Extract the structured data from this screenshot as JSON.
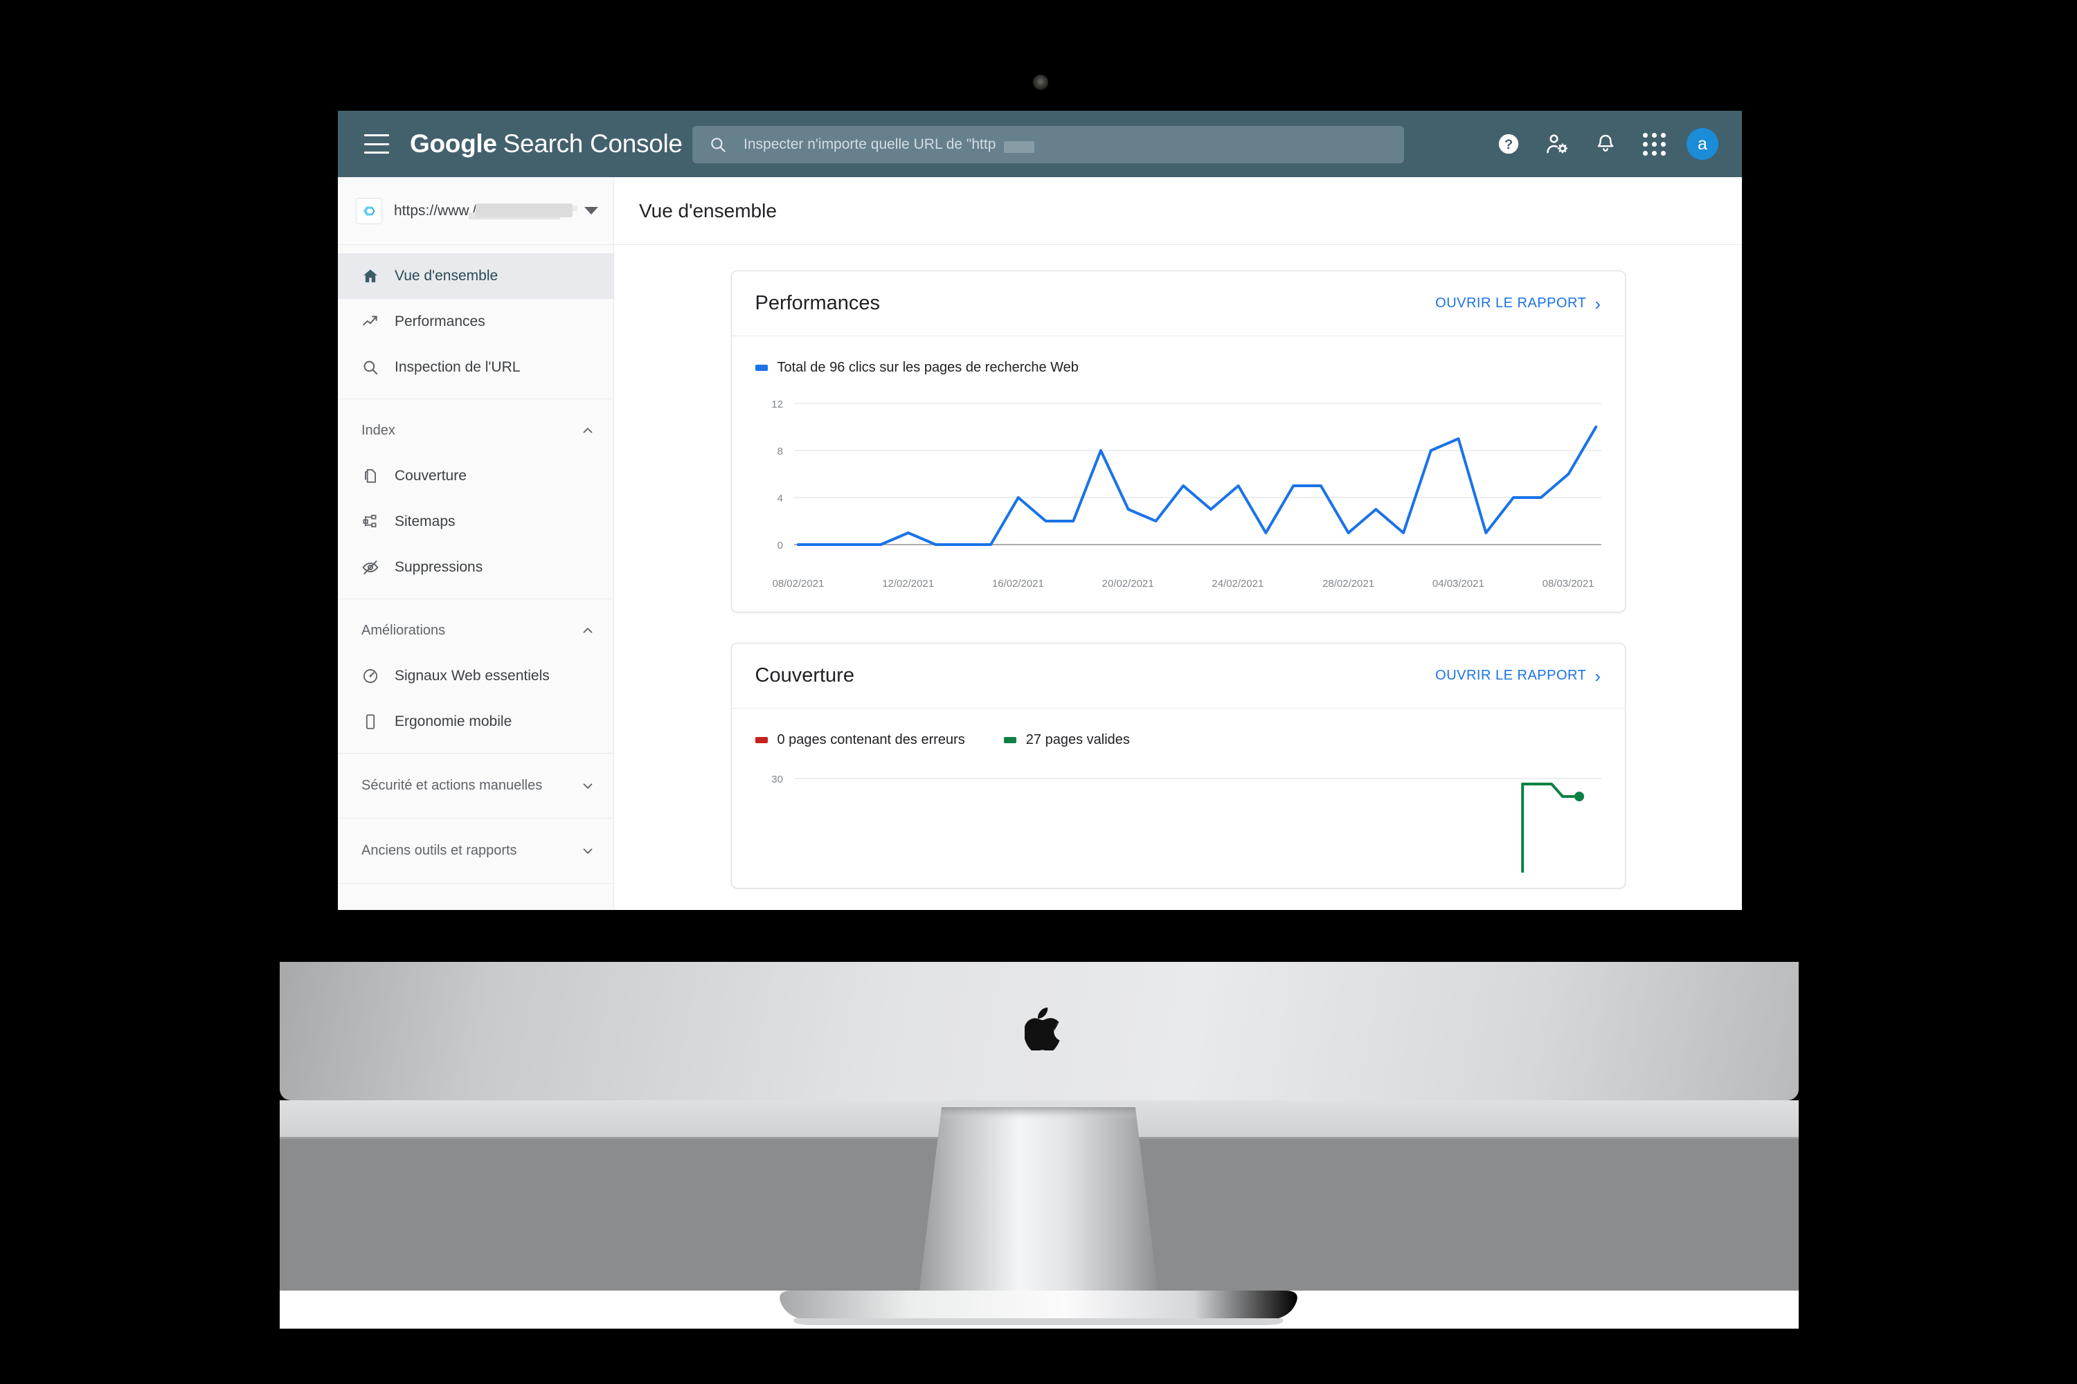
{
  "app": {
    "brand_google": "Google",
    "brand_rest": "Search Console",
    "menu_icon": "hamburger-icon"
  },
  "search": {
    "placeholder": "Inspecter n'importe quelle URL de \"http",
    "value": "",
    "icon": "search-icon"
  },
  "appbar_actions": [
    {
      "name": "help-icon",
      "label": "Aide"
    },
    {
      "name": "user-settings-icon",
      "label": "Paramètres utilisateur"
    },
    {
      "name": "notifications-bell-icon",
      "label": "Notifications"
    },
    {
      "name": "apps-grid-icon",
      "label": "Applications Google"
    }
  ],
  "avatar": {
    "initial": "a",
    "color": "#1a8cd8"
  },
  "property": {
    "url": "https://www.//wwe",
    "logo": "property-logo-c",
    "caret": "chevron-down-icon"
  },
  "sidebar": {
    "primary": [
      {
        "label": "Vue d'ensemble",
        "icon": "home-icon",
        "active": true
      },
      {
        "label": "Performances",
        "icon": "trending-up-icon",
        "active": false
      },
      {
        "label": "Inspection de l'URL",
        "icon": "search-icon",
        "active": false
      }
    ],
    "index": {
      "header": "Index",
      "expanded": true,
      "items": [
        {
          "label": "Couverture",
          "icon": "pages-copy-icon"
        },
        {
          "label": "Sitemaps",
          "icon": "sitemap-icon"
        },
        {
          "label": "Suppressions",
          "icon": "eye-off-icon"
        }
      ]
    },
    "improvements": {
      "header": "Améliorations",
      "expanded": true,
      "items": [
        {
          "label": "Signaux Web essentiels",
          "icon": "speedometer-icon"
        },
        {
          "label": "Ergonomie mobile",
          "icon": "mobile-phone-icon"
        }
      ]
    },
    "sections": [
      {
        "label": "Sécurité et actions manuelles",
        "expanded": false
      },
      {
        "label": "Anciens outils et rapports",
        "expanded": false
      }
    ]
  },
  "page": {
    "title": "Vue d'ensemble"
  },
  "cards": [
    {
      "title": "Performances",
      "open_report": "OUVRIR LE RAPPORT",
      "legend": [
        {
          "label": "Total de 96 clics sur les pages de recherche Web",
          "color": "#1a73e8"
        }
      ]
    },
    {
      "title": "Couverture",
      "open_report": "OUVRIR LE RAPPORT",
      "legend": [
        {
          "label": "0 pages contenant des erreurs",
          "color": "#c5221f"
        },
        {
          "label": "27 pages valides",
          "color": "#0d8043"
        }
      ]
    }
  ],
  "chart_data": [
    {
      "type": "line",
      "title": "Performances",
      "xlabel": "",
      "ylabel": "",
      "legend_position": "top-left",
      "grid": true,
      "ylim": [
        0,
        12
      ],
      "yticks": [
        0,
        4,
        8,
        12
      ],
      "ytick_labels": [
        "0",
        "4",
        "8",
        "12"
      ],
      "xtick_labels": [
        "08/02/2021",
        "12/02/2021",
        "16/02/2021",
        "20/02/2021",
        "24/02/2021",
        "28/02/2021",
        "04/03/2021",
        "08/03/2021"
      ],
      "series": [
        {
          "name": "Total de 96 clics sur les pages de recherche Web",
          "color": "#1a73e8",
          "x": [
            "08/02/2021",
            "09/02/2021",
            "10/02/2021",
            "11/02/2021",
            "12/02/2021",
            "13/02/2021",
            "14/02/2021",
            "15/02/2021",
            "16/02/2021",
            "17/02/2021",
            "18/02/2021",
            "19/02/2021",
            "20/02/2021",
            "21/02/2021",
            "22/02/2021",
            "23/02/2021",
            "24/02/2021",
            "25/02/2021",
            "26/02/2021",
            "27/02/2021",
            "28/02/2021",
            "01/03/2021",
            "02/03/2021",
            "03/03/2021",
            "04/03/2021",
            "05/03/2021",
            "06/03/2021",
            "07/03/2021",
            "08/03/2021",
            "09/03/2021"
          ],
          "values": [
            0,
            0,
            0,
            0,
            1,
            0,
            0,
            0,
            4,
            2,
            2,
            8,
            3,
            2,
            5,
            3,
            5,
            1,
            5,
            5,
            1,
            3,
            1,
            8,
            9,
            1,
            4,
            4,
            6,
            10
          ]
        }
      ],
      "total_label": "Total de 96 clics sur les pages de recherche Web"
    },
    {
      "type": "line",
      "title": "Couverture",
      "grid": true,
      "ylim": [
        0,
        33
      ],
      "yticks": [
        30
      ],
      "ytick_labels": [
        "30"
      ],
      "truncated": true,
      "series": [
        {
          "name": "0 pages contenant des erreurs",
          "color": "#c5221f",
          "values": [
            0,
            0,
            0,
            0,
            0,
            0,
            0
          ]
        },
        {
          "name": "27 pages valides",
          "color": "#0d8043",
          "values": [
            0,
            0,
            0,
            0,
            0,
            29,
            27
          ]
        }
      ]
    }
  ],
  "device": {
    "brand_logo": "apple-logo",
    "camera": "camera-dot"
  }
}
